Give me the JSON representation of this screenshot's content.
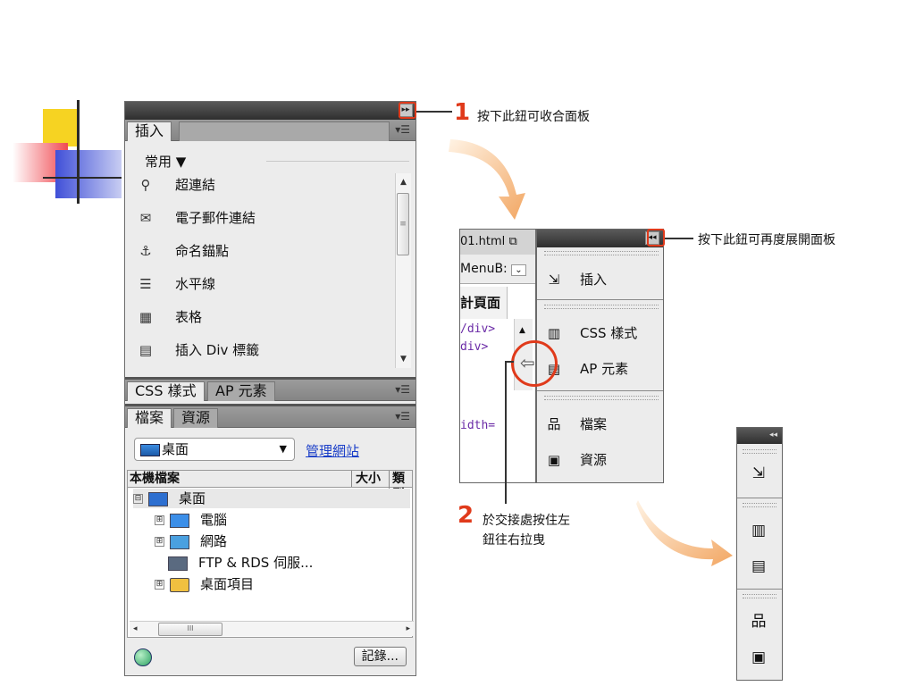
{
  "panel": {
    "insert_tab": "插入",
    "category": "常用",
    "insert_items": [
      {
        "icon": "hyperlink-icon",
        "glyph": "⚲",
        "label": "超連結"
      },
      {
        "icon": "email-link-icon",
        "glyph": "✉",
        "label": "電子郵件連結"
      },
      {
        "icon": "anchor-icon",
        "glyph": "⚓",
        "label": "命名錨點"
      },
      {
        "icon": "horizontal-rule-icon",
        "glyph": "☰",
        "label": "水平線"
      },
      {
        "icon": "table-icon",
        "glyph": "▦",
        "label": "表格"
      },
      {
        "icon": "insert-div-icon",
        "glyph": "▤",
        "label": "插入 Div 標籤"
      }
    ],
    "tab_css": "CSS 樣式",
    "tab_ap": "AP 元素",
    "tab_files": "檔案",
    "tab_assets": "資源",
    "site_select": "桌面",
    "manage_sites": "管理網站",
    "columns": {
      "local": "本機檔案",
      "size": "大小",
      "type": "類型"
    },
    "tree": [
      {
        "label": "桌面",
        "expander": "⊟",
        "level": 0
      },
      {
        "label": "電腦",
        "expander": "⊞",
        "level": 1
      },
      {
        "label": "網路",
        "expander": "⊞",
        "level": 1
      },
      {
        "label": "FTP & RDS 伺服...",
        "expander": "",
        "level": 1
      },
      {
        "label": "桌面項目",
        "expander": "⊞",
        "level": 1
      }
    ],
    "log_button": "記錄..."
  },
  "annotations": {
    "num1": "1",
    "note1": "按下此鈕可收合面板",
    "note2": "按下此鈕可再度展開面板",
    "num2": "2",
    "note3_line1": "於交接處按住左",
    "note3_line2": "鈕往右拉曳"
  },
  "dock": {
    "doc_tab": "01.html",
    "doc_row2": "MenuB:",
    "doc_row3": "計頁面",
    "code_lines": [
      "/div>",
      "div>",
      "idth="
    ],
    "items": [
      {
        "icon": "insert-icon",
        "glyph": "⇲",
        "label": "插入"
      },
      {
        "icon": "css-styles-icon",
        "glyph": "▥",
        "label": "CSS 樣式"
      },
      {
        "icon": "ap-elements-icon",
        "glyph": "▤",
        "label": "AP 元素"
      },
      {
        "icon": "files-icon",
        "glyph": "品",
        "label": "檔案"
      },
      {
        "icon": "assets-icon",
        "glyph": "▣",
        "label": "資源"
      }
    ]
  },
  "strip": {
    "icons": [
      {
        "icon": "insert-icon",
        "glyph": "⇲"
      },
      {
        "icon": "css-styles-icon",
        "glyph": "▥"
      },
      {
        "icon": "ap-elements-icon",
        "glyph": "▤"
      },
      {
        "icon": "files-icon",
        "glyph": "品"
      },
      {
        "icon": "assets-icon",
        "glyph": "▣"
      }
    ]
  }
}
